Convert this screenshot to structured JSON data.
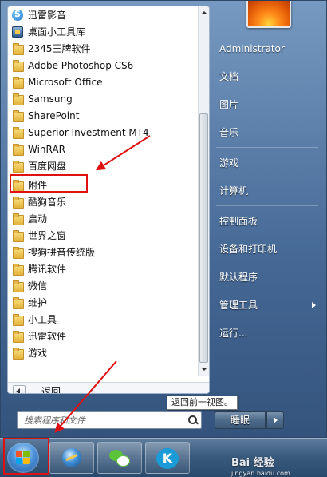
{
  "programs": [
    {
      "label": "迅雷影音",
      "icon": "xunlei-player-icon"
    },
    {
      "label": "桌面小工具库",
      "icon": "gadget-gallery-icon"
    },
    {
      "label": "2345王牌软件",
      "icon": "folder-icon"
    },
    {
      "label": "Adobe Photoshop CS6",
      "icon": "folder-icon"
    },
    {
      "label": "Microsoft Office",
      "icon": "folder-icon"
    },
    {
      "label": "Samsung",
      "icon": "folder-icon"
    },
    {
      "label": "SharePoint",
      "icon": "folder-icon"
    },
    {
      "label": "Superior Investment MT4",
      "icon": "folder-icon"
    },
    {
      "label": "WinRAR",
      "icon": "folder-icon"
    },
    {
      "label": "百度网盘",
      "icon": "folder-icon"
    },
    {
      "label": "附件",
      "icon": "folder-icon"
    },
    {
      "label": "酷狗音乐",
      "icon": "folder-icon"
    },
    {
      "label": "启动",
      "icon": "folder-icon"
    },
    {
      "label": "世界之窗",
      "icon": "folder-icon"
    },
    {
      "label": "搜狗拼音传统版",
      "icon": "folder-icon"
    },
    {
      "label": "腾讯软件",
      "icon": "folder-icon"
    },
    {
      "label": "微信",
      "icon": "folder-icon"
    },
    {
      "label": "维护",
      "icon": "folder-icon"
    },
    {
      "label": "小工具",
      "icon": "folder-icon"
    },
    {
      "label": "迅雷软件",
      "icon": "folder-icon"
    },
    {
      "label": "游戏",
      "icon": "folder-icon"
    }
  ],
  "back_label": "返回",
  "search": {
    "placeholder": "搜索程序和文件"
  },
  "right_pane": {
    "user": "Administrator",
    "items": [
      "文档",
      "图片",
      "音乐",
      "游戏",
      "计算机",
      "控制面板",
      "设备和打印机",
      "默认程序",
      "管理工具",
      "运行..."
    ]
  },
  "shutdown_label": "睡眠",
  "tooltip": "返回前一视图。",
  "watermark": {
    "brand": "Bai 经验",
    "url": "jingyan.baidu.com"
  },
  "colors": {
    "annotation": "#e01010"
  }
}
